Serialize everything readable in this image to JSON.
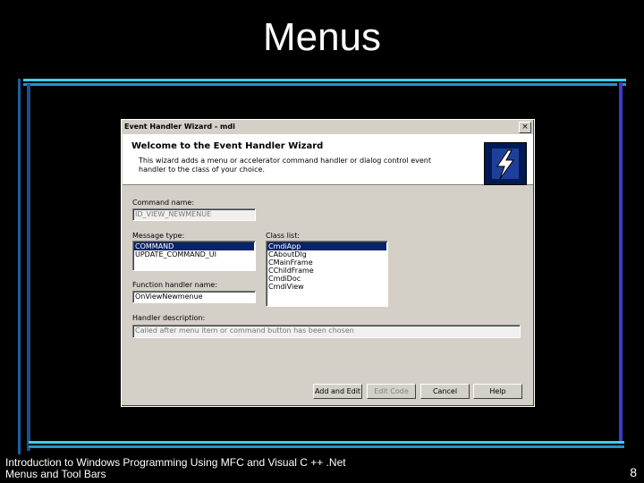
{
  "slide": {
    "title": "Menus",
    "footer_line1": "Introduction to Windows Programming Using MFC and Visual C ++ .Net",
    "footer_line2": "Menus and Tool Bars",
    "page_number": "8"
  },
  "dialog": {
    "title": "Event Handler Wizard - mdi",
    "close_glyph": "×",
    "header_title": "Welcome to the Event Handler Wizard",
    "header_desc": "This wizard adds a menu or accelerator command handler or dialog control event handler to the class of your choice.",
    "command_name_label": "Command name:",
    "command_name_value": "ID_VIEW_NEWMENUE",
    "message_type_label": "Message type:",
    "message_types": [
      "COMMAND",
      "UPDATE_COMMAND_UI"
    ],
    "class_list_label": "Class list:",
    "classes": [
      "CmdiApp",
      "CAboutDlg",
      "CMainFrame",
      "CChildFrame",
      "CmdiDoc",
      "CmdiView"
    ],
    "function_label": "Function handler name:",
    "function_value": "OnViewNewmenue",
    "description_label": "Handler description:",
    "description_value": "Called after menu item or command button has been chosen",
    "buttons": {
      "add_edit": "Add and Edit",
      "edit_code": "Edit Code",
      "cancel": "Cancel",
      "help": "Help"
    }
  }
}
